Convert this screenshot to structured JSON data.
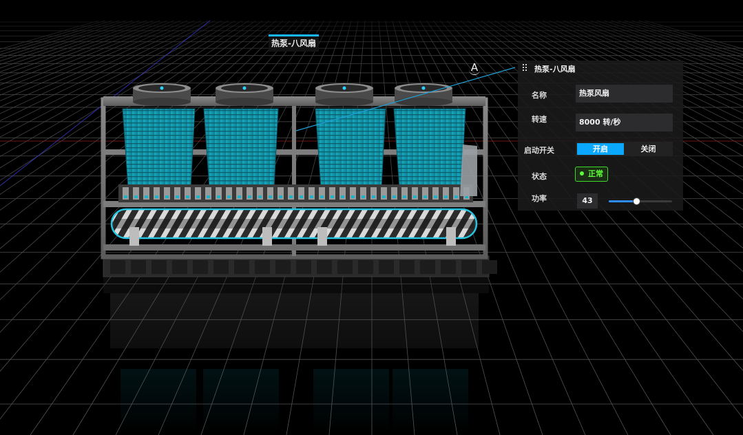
{
  "scene": {
    "model_label": "热泵-八风扇",
    "anchor_marker": "A"
  },
  "panel": {
    "title": "热泵-八风扇",
    "name_label": "名称",
    "name_value": "热泵风扇",
    "speed_label": "转速",
    "speed_value": "8000 转/秒",
    "switch_label": "启动开关",
    "switch_on": "开启",
    "switch_off": "关闭",
    "switch_state": "on",
    "status_label": "状态",
    "status_value": "正常",
    "power_label": "功率",
    "power_value": "43",
    "power_max": 100
  },
  "colors": {
    "accent": "#0aa8ff",
    "status_ok": "#5cff3a",
    "coil_teal": "#1fb3c8",
    "grid": "#5a5a5a"
  },
  "icons": {
    "drag_handle": "drag-handle-icon",
    "status_dot": "status-dot-icon"
  }
}
